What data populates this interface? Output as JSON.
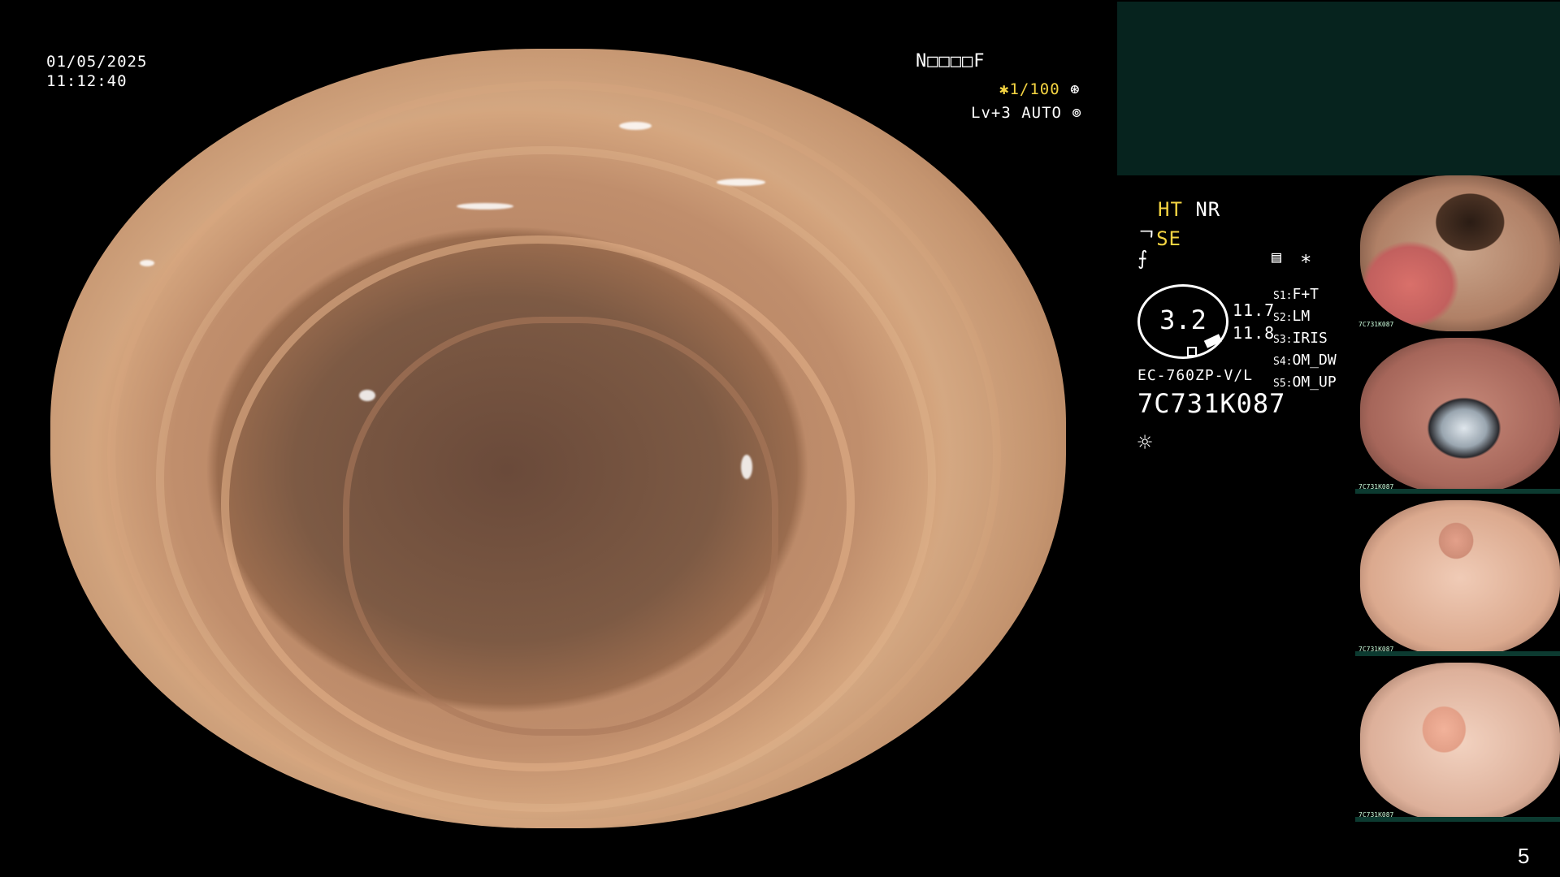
{
  "header": {
    "date": "01/05/2025",
    "time": "11:12:40",
    "patient_id": "N□□□□F",
    "shutter": "✱1/100",
    "shutter_icon": "⊛",
    "level": "Lv+3 AUTO",
    "level_icon": "⊚"
  },
  "panel": {
    "ht": "HT",
    "nr": "NR",
    "se_prefix": "ᄀ",
    "se": "SE",
    "sym1": "⨍",
    "sym2": "▤",
    "sym3": "∗",
    "gauge_value": "3.2",
    "val1": "11.7",
    "val2": "11.8",
    "presets": [
      {
        "key": "S1:",
        "val": "F+T"
      },
      {
        "key": "S2:",
        "val": "LM"
      },
      {
        "key": "S3:",
        "val": "IRIS"
      },
      {
        "key": "S4:",
        "val": "OM_DW"
      },
      {
        "key": "S5:",
        "val": "OM_UP"
      }
    ],
    "scope_model": "EC-760ZP-V/L",
    "serial": "7C731K087",
    "light_icon": "☼"
  },
  "thumbnails": [
    {
      "label": "7C731K087"
    },
    {
      "label": "7C731K087"
    },
    {
      "label": "7C731K087"
    },
    {
      "label": "7C731K087"
    }
  ],
  "page_number": "5",
  "colors": {
    "yellow": "#f5d442",
    "panel_bg": "#06231e"
  }
}
